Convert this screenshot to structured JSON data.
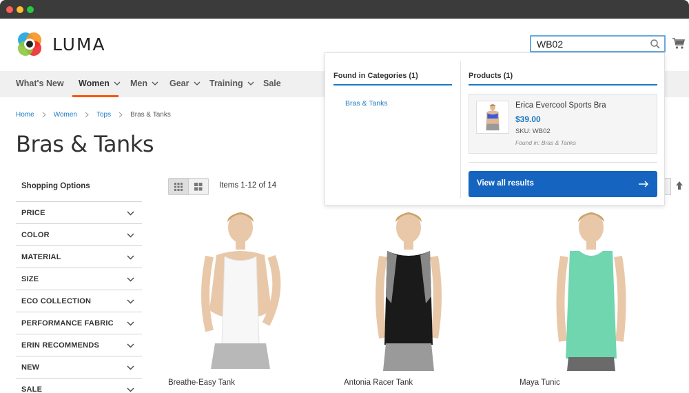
{
  "window": {
    "controls": [
      "close",
      "minimize",
      "maximize"
    ]
  },
  "header": {
    "brand": "LUMA",
    "search": {
      "value": "WB02",
      "placeholder": ""
    },
    "icons": {
      "search": "search-icon",
      "cart": "cart-icon"
    }
  },
  "nav": {
    "items": [
      {
        "label": "What's New",
        "has_chevron": false
      },
      {
        "label": "Women",
        "has_chevron": true,
        "active": true
      },
      {
        "label": "Men",
        "has_chevron": true
      },
      {
        "label": "Gear",
        "has_chevron": true
      },
      {
        "label": "Training",
        "has_chevron": true
      },
      {
        "label": "Sale",
        "has_chevron": false
      }
    ],
    "active_color": "#ff5501"
  },
  "breadcrumb": {
    "items": [
      "Home",
      "Women",
      "Tops"
    ],
    "current": "Bras & Tanks"
  },
  "page": {
    "title": "Bras & Tanks"
  },
  "filters": {
    "heading": "Shopping Options",
    "items": [
      "PRICE",
      "COLOR",
      "MATERIAL",
      "SIZE",
      "ECO COLLECTION",
      "PERFORMANCE FABRIC",
      "ERIN RECOMMENDS",
      "NEW",
      "SALE"
    ]
  },
  "toolbar": {
    "count": "Items 1-12 of 14"
  },
  "products": [
    {
      "name": "Breathe-Easy Tank",
      "color": "#f4f4f4"
    },
    {
      "name": "Antonia Racer Tank",
      "color": "#1a1a1a"
    },
    {
      "name": "Maya Tunic",
      "color": "#6fd6b0"
    }
  ],
  "autocomplete": {
    "categories_heading": "Found in Categories (1)",
    "category_link": "Bras & Tanks",
    "products_heading": "Products (1)",
    "product": {
      "name": "Erica Evercool Sports Bra",
      "price": "$39.00",
      "sku": "SKU: WB02",
      "found_in": "Found in: Bras & Tanks"
    },
    "view_all": "View all results",
    "accent": "#1979c3",
    "button_color": "#1565c0"
  }
}
